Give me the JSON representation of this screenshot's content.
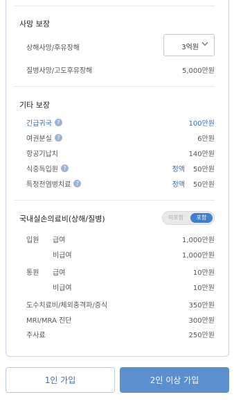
{
  "death": {
    "title": "사망 보장",
    "injury_label": "상해사망/후유장해",
    "injury_selected": "3억원",
    "illness_label": "질병사망/고도후유장해",
    "illness_value": "5,000만원"
  },
  "other": {
    "title": "기타 보장",
    "items": [
      {
        "label": "긴급귀국",
        "value": "100만원",
        "extra": ""
      },
      {
        "label": "여권분실",
        "value": "6만원",
        "extra": ""
      },
      {
        "label": "항공기납치",
        "value": "140만원",
        "extra": ""
      },
      {
        "label": "식중독입원",
        "value": "50만원",
        "extra": "정액"
      },
      {
        "label": "특정전염병치료",
        "value": "50만원",
        "extra": "정액"
      }
    ]
  },
  "medical": {
    "title": "국내실손의료비(상해/질병)",
    "toggle_off": "미포함",
    "toggle_on": "포함",
    "rows": [
      {
        "cat": "입원",
        "sub": "급여",
        "value": "1,000만원"
      },
      {
        "cat": "",
        "sub": "비급여",
        "value": "1,000만원"
      },
      {
        "cat": "통원",
        "sub": "급여",
        "value": "10만원"
      },
      {
        "cat": "",
        "sub": "비급여",
        "value": "10만원"
      },
      {
        "cat": "도수치료비/체외충격파/증식",
        "sub": "",
        "value": "350만원"
      },
      {
        "cat": "MRI/MRA 진단",
        "sub": "",
        "value": "300만원"
      },
      {
        "cat": "주사료",
        "sub": "",
        "value": "250만원"
      }
    ]
  },
  "buttons": {
    "single": "1인 가입",
    "multi": "2인 이상 가입"
  }
}
